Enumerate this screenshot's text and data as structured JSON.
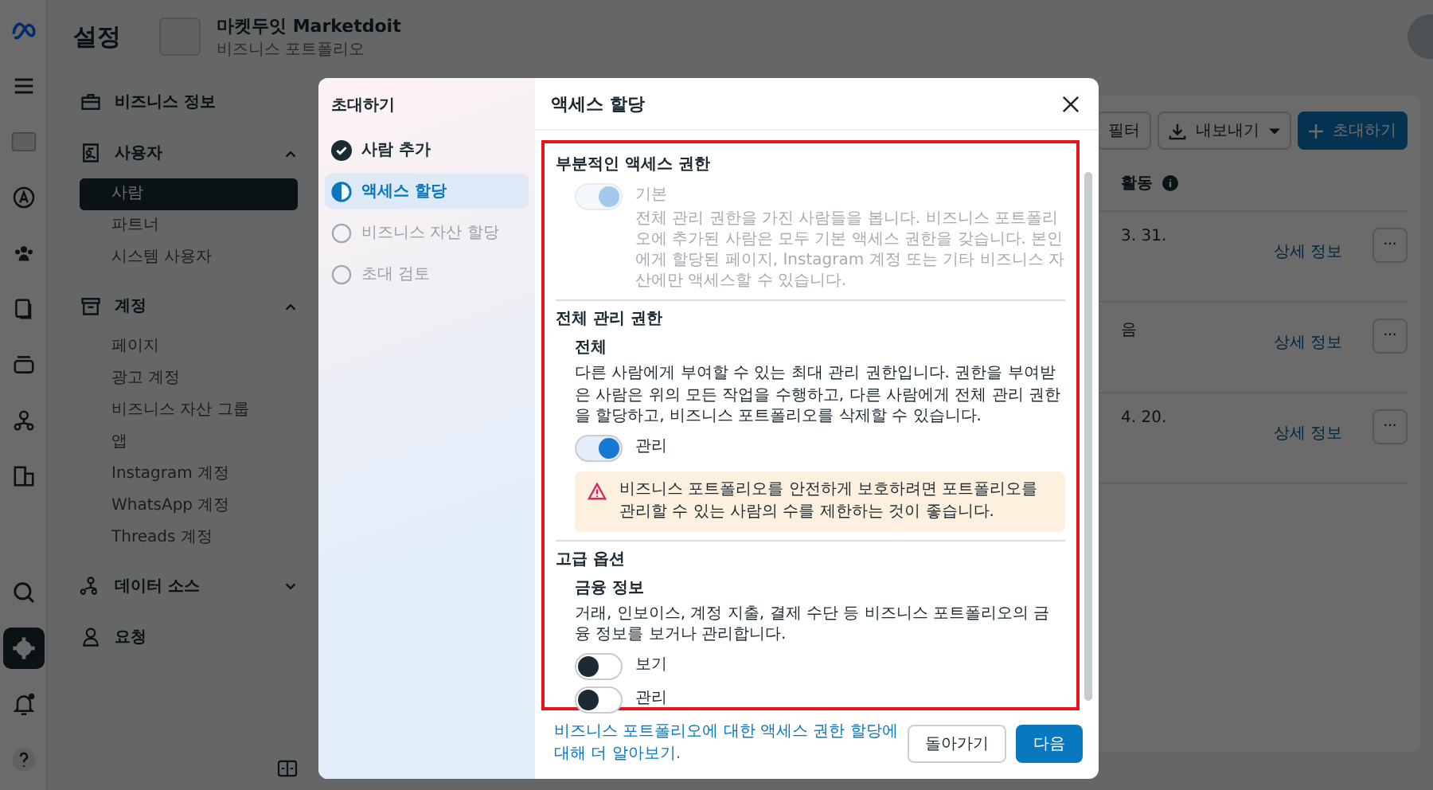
{
  "rail": {
    "top": [
      {
        "kind": "logo",
        "selected": false
      },
      {
        "kind": "menu",
        "selected": false
      },
      {
        "kind": "portfolio",
        "selected": false
      },
      {
        "kind": "ads",
        "selected": false
      },
      {
        "kind": "people",
        "selected": false
      },
      {
        "kind": "pages",
        "selected": false
      },
      {
        "kind": "stack",
        "selected": false
      },
      {
        "kind": "network",
        "selected": false
      },
      {
        "kind": "building",
        "selected": false
      }
    ],
    "bottom": [
      {
        "kind": "search",
        "selected": false
      },
      {
        "kind": "settings",
        "selected": true
      },
      {
        "kind": "bell",
        "selected": false
      },
      {
        "kind": "help",
        "selected": false
      }
    ]
  },
  "header": {
    "title": "설정",
    "portfolio_name": "마켓두잇 Marketdoit",
    "portfolio_type": "비즈니스 포트폴리오"
  },
  "nav": [
    {
      "label": "비즈니스 정보",
      "kind": "briefcase"
    },
    {
      "label": "사용자",
      "kind": "badge",
      "expanded": true,
      "children": [
        {
          "label": "사람",
          "selected": true
        },
        {
          "label": "파트너",
          "selected": false
        },
        {
          "label": "시스템 사용자",
          "selected": false
        }
      ]
    },
    {
      "label": "계정",
      "kind": "archive",
      "expanded": true,
      "children": [
        {
          "label": "페이지",
          "selected": false
        },
        {
          "label": "광고 계정",
          "selected": false
        },
        {
          "label": "비즈니스 자산 그룹",
          "selected": false
        },
        {
          "label": "앱",
          "selected": false
        },
        {
          "label": "Instagram 계정",
          "selected": false
        },
        {
          "label": "WhatsApp 계정",
          "selected": false
        },
        {
          "label": "Threads 계정",
          "selected": false
        }
      ]
    },
    {
      "label": "데이터 소스",
      "kind": "network",
      "expanded": false
    },
    {
      "label": "요청",
      "kind": "person"
    }
  ],
  "toolbar": {
    "filter": "필터",
    "export": "내보내기",
    "invite": "초대하기"
  },
  "table": {
    "column_header": "활동",
    "rows": [
      {
        "cell": "3. 31.",
        "link": "상세 정보",
        "more": "···"
      },
      {
        "cell": "음",
        "link": "상세 정보",
        "more": "···"
      },
      {
        "cell": "4. 20.",
        "link": "상세 정보",
        "more": "···"
      }
    ]
  },
  "modal": {
    "sidebar_title": "초대하기",
    "steps": [
      {
        "label": "사람 추가",
        "kind": "done",
        "selected": false
      },
      {
        "label": "액세스 할당",
        "kind": "current",
        "selected": true
      },
      {
        "label": "비즈니스 자산 할당",
        "kind": "pending",
        "selected": false
      },
      {
        "label": "초대 검토",
        "kind": "pending",
        "selected": false
      }
    ],
    "title": "액세스 할당",
    "sections": [
      {
        "title": "부분적인 액세스 권한",
        "options": [
          {
            "label": "기본",
            "description": "전체 관리 권한을 가진 사람들을 봅니다. 비즈니스 포트폴리오에 추가된 사람은 모두 기본 액세스 권한을 갖습니다. 본인에게 할당된 페이지, Instagram 계정 또는 기타 비즈니스 자산에만 액세스할 수 있습니다.",
            "on": true,
            "disabled": true
          }
        ]
      },
      {
        "title": "전체 관리 권한",
        "subtitle": "전체",
        "description": "다른 사람에게 부여할 수 있는 최대 관리 권한입니다. 권한을 부여받은 사람은 위의 모든 작업을 수행하고, 다른 사람에게 전체 관리 권한을 할당하고, 비즈니스 포트폴리오를 삭제할 수 있습니다.",
        "options": [
          {
            "label": "관리",
            "on": true,
            "disabled": false
          }
        ],
        "warning": "비즈니스 포트폴리오를 안전하게 보호하려면 포트폴리오를 관리할 수 있는 사람의 수를 제한하는 것이 좋습니다."
      },
      {
        "title": "고급 옵션",
        "subtitle": "금융 정보",
        "description": "거래, 인보이스, 계정 지출, 결제 수단 등 비즈니스 포트폴리오의 금융 정보를 보거나 관리합니다.",
        "options": [
          {
            "label": "보기",
            "on": false,
            "disabled": false
          },
          {
            "label": "관리",
            "on": false,
            "disabled": false
          }
        ]
      }
    ],
    "learn_more": "비즈니스 포트폴리오에 대한 액세스 권한 할당에 대해 더 알아보기.",
    "back": "돌아가기",
    "next": "다음"
  }
}
